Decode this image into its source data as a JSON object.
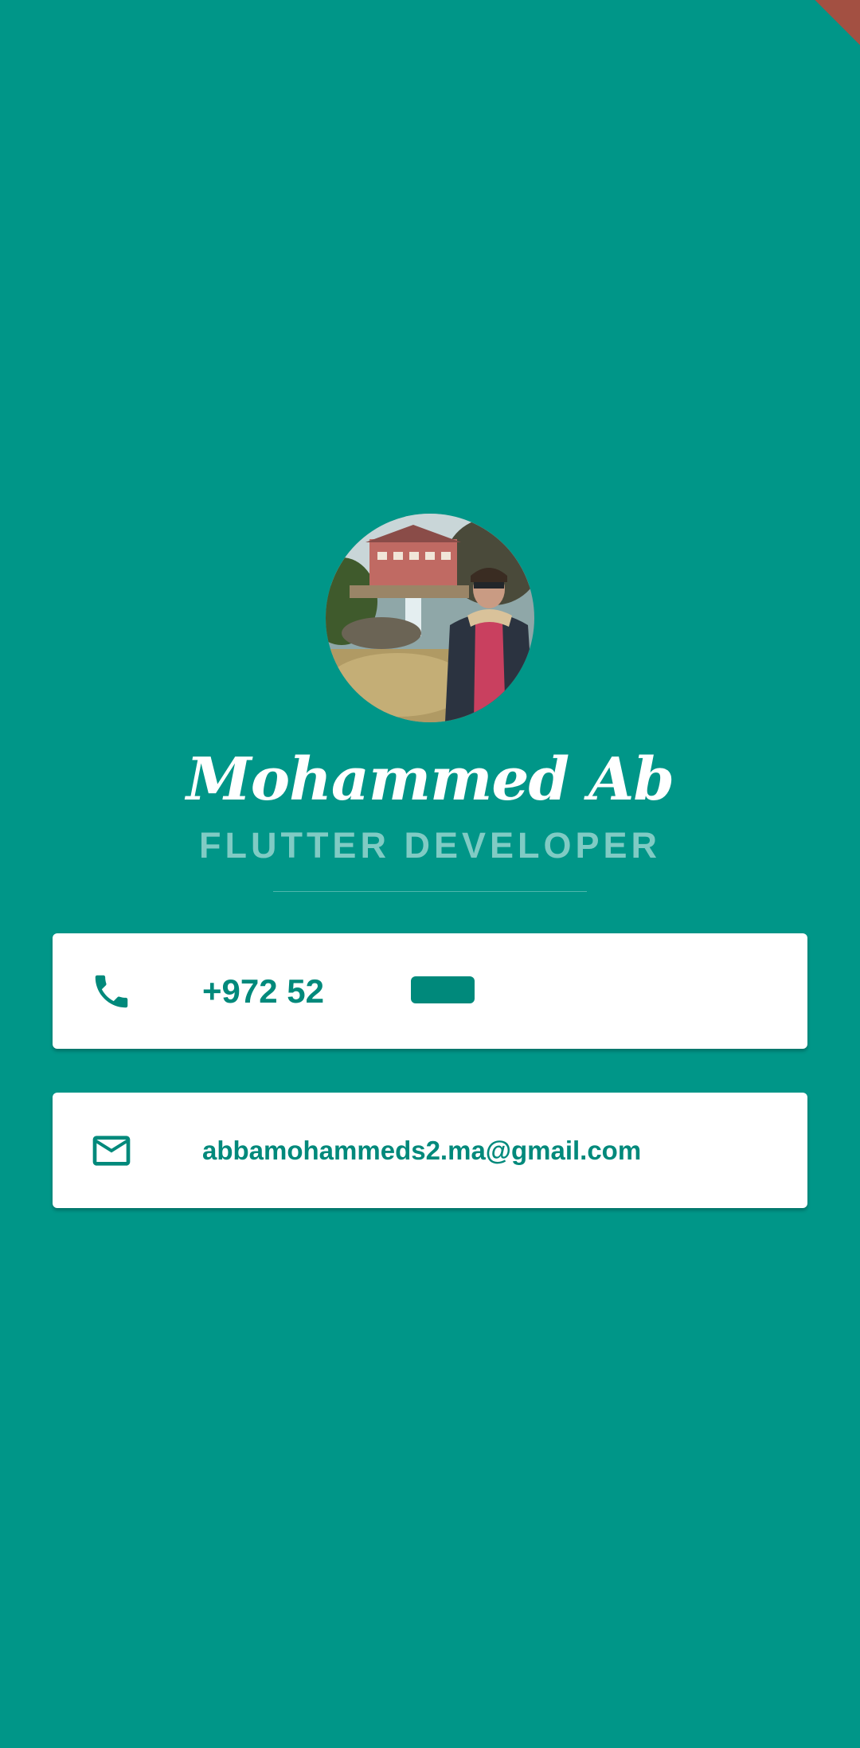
{
  "profile": {
    "name": "Mohammed Ab",
    "role": "FLUTTER DEVELOPER",
    "avatar_icon": "profile-photo"
  },
  "contacts": {
    "phone": {
      "icon": "phone-icon",
      "text": "+972 52"
    },
    "email": {
      "icon": "mail-icon",
      "text": "abbamohammeds2.ma@gmail.com"
    }
  },
  "colors": {
    "background": "#009688",
    "accent_text": "#00897b",
    "role_text": "#80cbc4",
    "card": "#ffffff"
  }
}
